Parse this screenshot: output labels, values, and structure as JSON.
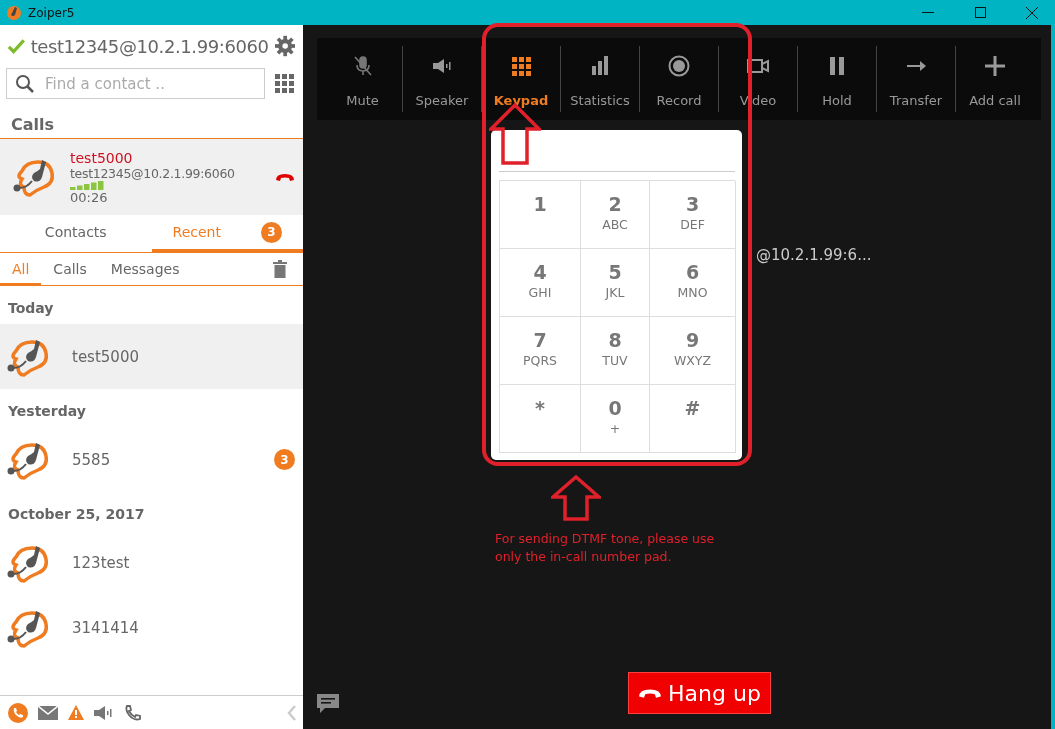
{
  "window": {
    "title": "Zoiper5"
  },
  "account": {
    "name": "test12345@10.2.1.99:6060",
    "registered": true
  },
  "search": {
    "placeholder": "Find a contact .."
  },
  "calls_heading": "Calls",
  "active_call": {
    "name": "test5000",
    "account": "test12345@10.2.1.99:6060",
    "duration": "00:26"
  },
  "tabs": [
    {
      "label": "Contacts",
      "selected": false
    },
    {
      "label": "Recent",
      "selected": true,
      "badge": "3"
    }
  ],
  "filters": [
    {
      "label": "All",
      "selected": true
    },
    {
      "label": "Calls",
      "selected": false
    },
    {
      "label": "Messages",
      "selected": false
    }
  ],
  "history": [
    {
      "date": "Today",
      "entries": [
        {
          "name": "test5000",
          "selected": true
        }
      ]
    },
    {
      "date": "Yesterday",
      "entries": [
        {
          "name": "5585",
          "selected": false,
          "badge": "3"
        }
      ]
    },
    {
      "date": "October 25, 2017",
      "entries": [
        {
          "name": "123test",
          "selected": false
        },
        {
          "name": "3141414",
          "selected": false
        }
      ]
    }
  ],
  "toolbar": [
    {
      "label": "Mute",
      "selected": false
    },
    {
      "label": "Speaker",
      "selected": false
    },
    {
      "label": "Keypad",
      "selected": true
    },
    {
      "label": "Statistics",
      "selected": false
    },
    {
      "label": "Record",
      "selected": false
    },
    {
      "label": "Video",
      "selected": false
    },
    {
      "label": "Hold",
      "selected": false
    },
    {
      "label": "Transfer",
      "selected": false
    },
    {
      "label": "Add call",
      "selected": false
    }
  ],
  "call_info_fragment": "@10.2.1.99:6...",
  "keypad": [
    {
      "digit": "1"
    },
    {
      "digit": "2",
      "letters": "ABC"
    },
    {
      "digit": "3",
      "letters": "DEF"
    },
    {
      "digit": "4",
      "letters": "GHI"
    },
    {
      "digit": "5",
      "letters": "JKL"
    },
    {
      "digit": "6",
      "letters": "MNO"
    },
    {
      "digit": "7",
      "letters": "PQRS"
    },
    {
      "digit": "8",
      "letters": "TUV"
    },
    {
      "digit": "9",
      "letters": "WXYZ"
    },
    {
      "digit": "*"
    },
    {
      "digit": "0",
      "letters": "+"
    },
    {
      "digit": "#"
    }
  ],
  "annotation": "For sending DTMF tone, please use only the in-call number pad.",
  "hangup": "Hang up"
}
